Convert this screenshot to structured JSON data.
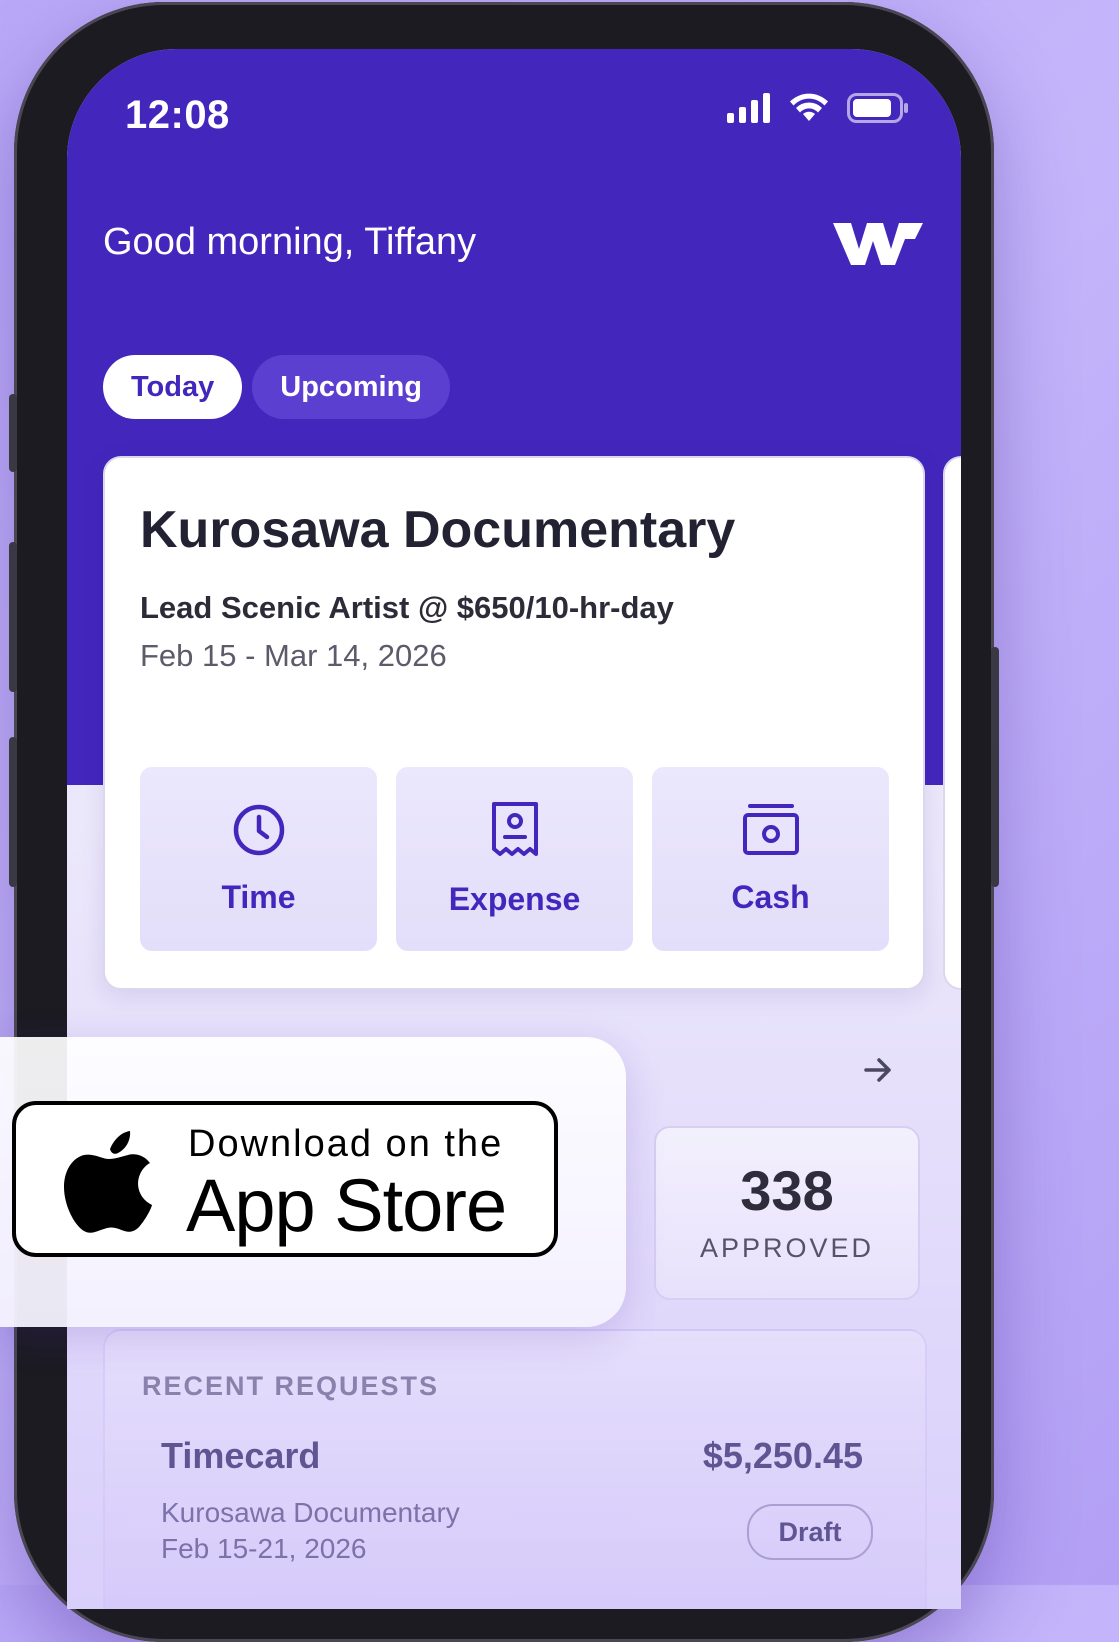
{
  "status_bar": {
    "time": "12:08"
  },
  "header": {
    "greeting": "Good morning, Tiffany"
  },
  "tabs": [
    {
      "label": "Today",
      "active": true
    },
    {
      "label": "Upcoming",
      "active": false
    }
  ],
  "project_card": {
    "title": "Kurosawa Documentary",
    "role": "Lead Scenic Artist @ $650/10-hr-day",
    "dates": "Feb 15 - Mar 14, 2026",
    "actions": [
      {
        "label": "Time",
        "icon": "clock-icon"
      },
      {
        "label": "Expense",
        "icon": "receipt-icon"
      },
      {
        "label": "Cash",
        "icon": "cash-icon"
      }
    ]
  },
  "stats": {
    "approved_count": "338",
    "approved_label": "APPROVED"
  },
  "recent_requests": {
    "label": "RECENT REQUESTS",
    "items": [
      {
        "title": "Timecard",
        "amount": "$5,250.45",
        "project": "Kurosawa Documentary",
        "dates": "Feb 15-21, 2026",
        "status": "Draft"
      }
    ]
  },
  "app_store_badge": {
    "line1": "Download on the",
    "line2": "App Store"
  },
  "colors": {
    "brand": "#4327bd",
    "background": "#c4b5fb"
  }
}
